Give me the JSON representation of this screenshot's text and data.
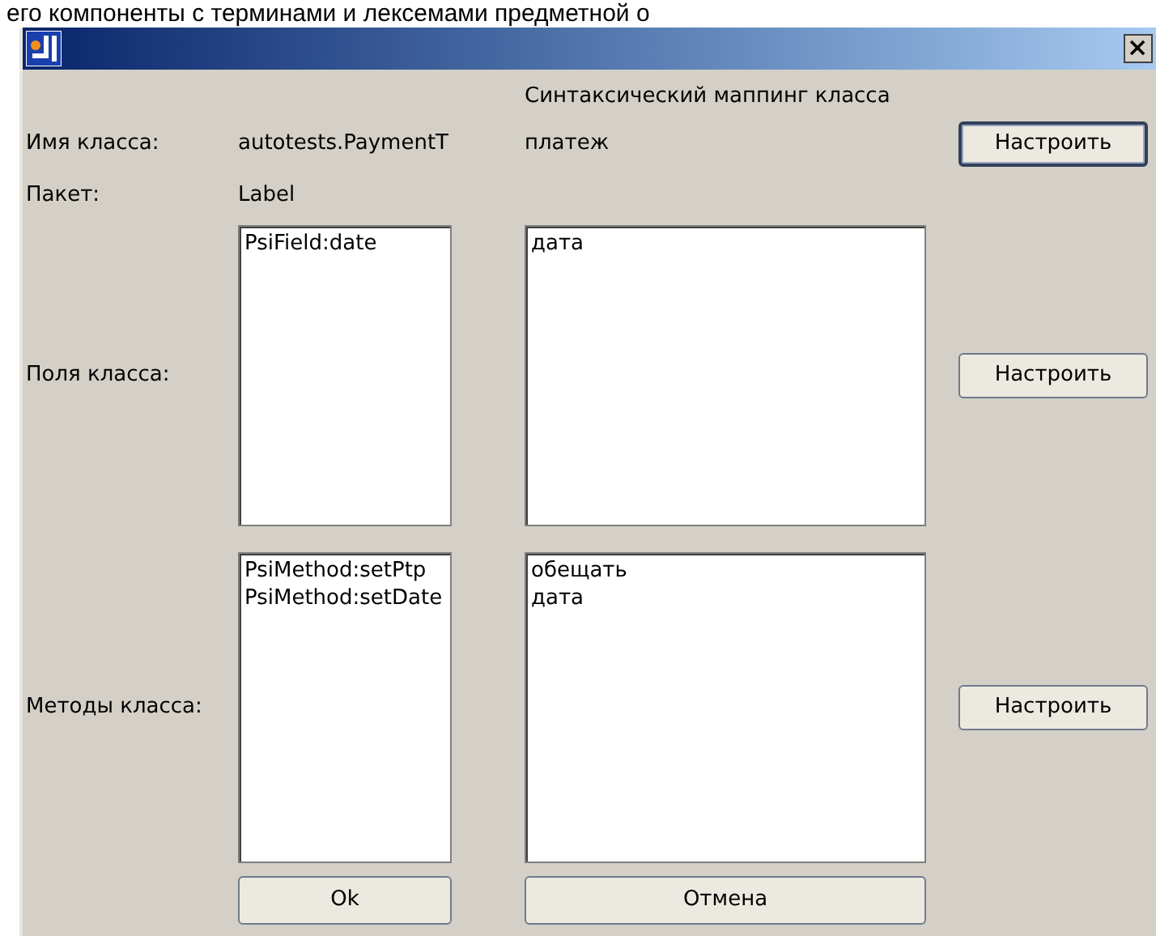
{
  "caption": "его компоненты с терминами и лексемами предметной о",
  "mapping_heading": "Синтаксический маппинг класса",
  "class_name": {
    "label": "Имя класса:",
    "value": "autotests.PaymentT",
    "mapping": "платеж",
    "button": {
      "label": "Настроить",
      "focused": true
    }
  },
  "package": {
    "label": "Пакет:",
    "value": "Label"
  },
  "fields": {
    "label": "Поля класса:",
    "items": [
      "PsiField:date"
    ],
    "mappings": [
      "дата"
    ],
    "button": {
      "label": "Настроить",
      "focused": false
    }
  },
  "methods": {
    "label": "Методы класса:",
    "items": [
      "PsiMethod:setPtp",
      "PsiMethod:setDate"
    ],
    "mappings": [
      "обещать",
      "дата"
    ],
    "button": {
      "label": "Настроить",
      "focused": false
    }
  },
  "buttons": [
    "Ok",
    "Отмена"
  ]
}
